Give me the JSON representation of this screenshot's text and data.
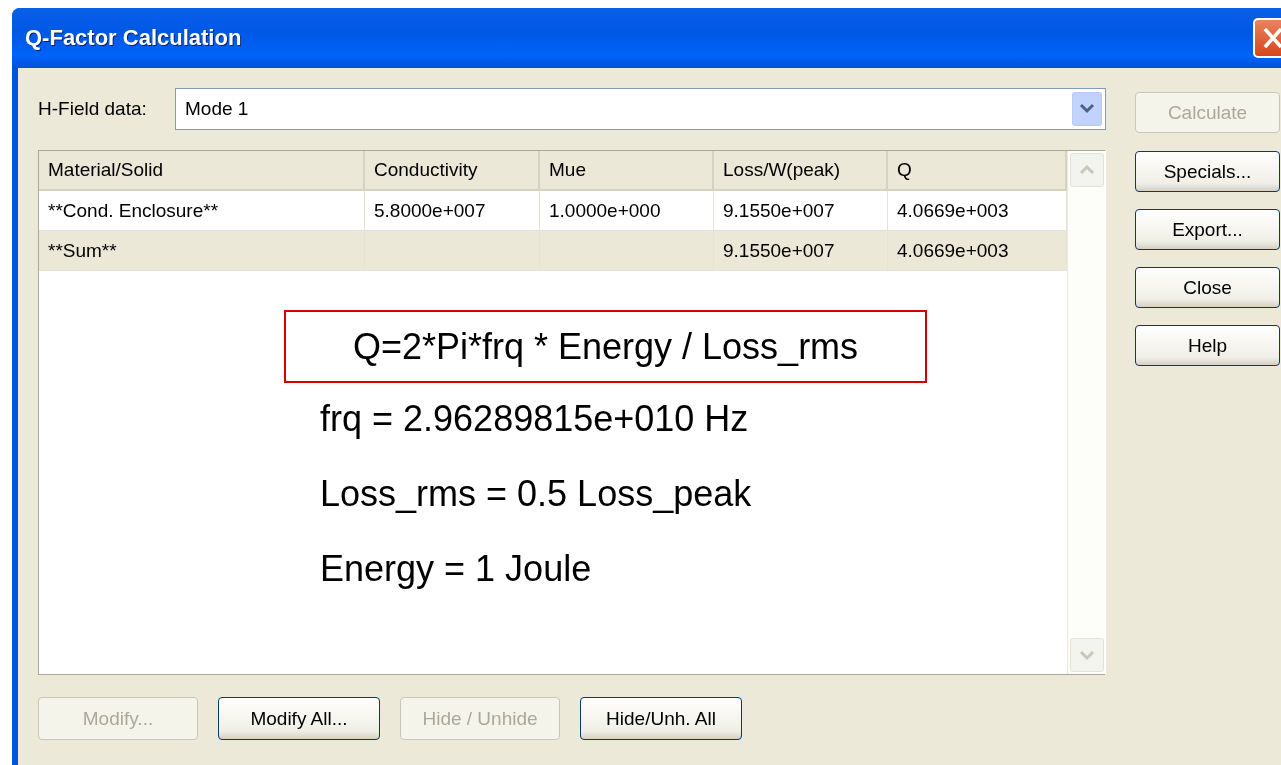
{
  "window": {
    "title": "Q-Factor Calculation"
  },
  "h_field": {
    "label": "H-Field data:",
    "value": "Mode 1"
  },
  "table": {
    "columns": [
      "Material/Solid",
      "Conductivity",
      "Mue",
      "Loss/W(peak)",
      "Q"
    ],
    "rows": [
      {
        "kind": "item",
        "cells": [
          "**Cond. Enclosure**",
          "5.8000e+007",
          "1.0000e+000",
          "9.1550e+007",
          "4.0669e+003"
        ]
      },
      {
        "kind": "sum",
        "cells": [
          "**Sum**",
          null,
          null,
          "9.1550e+007",
          "4.0669e+003"
        ]
      }
    ]
  },
  "annotation": {
    "formula": "Q=2*Pi*frq * Energy / Loss_rms",
    "notes": [
      "frq = 2.96289815e+010 Hz",
      "Loss_rms = 0.5 Loss_peak",
      "Energy = 1 Joule"
    ]
  },
  "side_buttons": [
    {
      "label": "Calculate",
      "disabled": true
    },
    {
      "label": "Specials...",
      "disabled": false
    },
    {
      "label": "Export...",
      "disabled": false
    },
    {
      "label": "Close",
      "disabled": false
    },
    {
      "label": "Help",
      "disabled": false
    }
  ],
  "bottom_buttons": [
    {
      "label": "Modify...",
      "disabled": true
    },
    {
      "label": "Modify All...",
      "disabled": false
    },
    {
      "label": "Hide / Unhide",
      "disabled": true
    },
    {
      "label": "Hide/Unh. All",
      "disabled": false
    }
  ]
}
